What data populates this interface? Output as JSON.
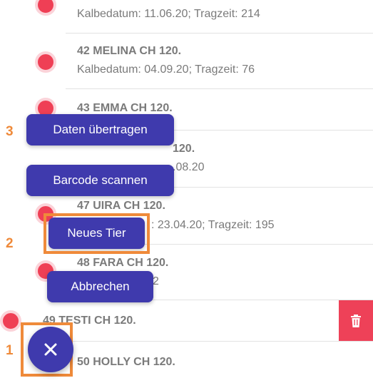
{
  "list": {
    "rows": [
      {
        "title": "",
        "subtitle": "Kalbedatum: 11.06.20; Tragzeit: 214"
      },
      {
        "title": "42 MELINA CH 120.",
        "subtitle": "Kalbedatum: 04.09.20; Tragzeit: 76"
      },
      {
        "title": "43 EMMA CH 120.",
        "subtitle": ""
      },
      {
        "title": "120.",
        "subtitle": ".08.20"
      },
      {
        "title": "47 UIRA CH 120.",
        "subtitle": ": 23.04.20; Tragzeit: 195"
      },
      {
        "title": "48 FARA CH 120.",
        "subtitle": "2"
      },
      {
        "title": "49 TESTI CH 120.",
        "subtitle": ""
      },
      {
        "title": "50 HOLLY CH 120.",
        "subtitle": ""
      }
    ]
  },
  "fab_menu": {
    "transfer_label": "Daten übertragen",
    "barcode_label": "Barcode scannen",
    "new_animal_label": "Neues Tier",
    "cancel_label": "Abbrechen"
  },
  "annotations": {
    "label_1": "1",
    "label_2": "2",
    "label_3": "3"
  },
  "icons": {
    "delete": "trash-icon",
    "fab": "close-icon"
  },
  "colors": {
    "primary": "#3f3aad",
    "record_dot": "#ef3f55",
    "delete": "#ee4158",
    "highlight": "#ef8a3a"
  }
}
